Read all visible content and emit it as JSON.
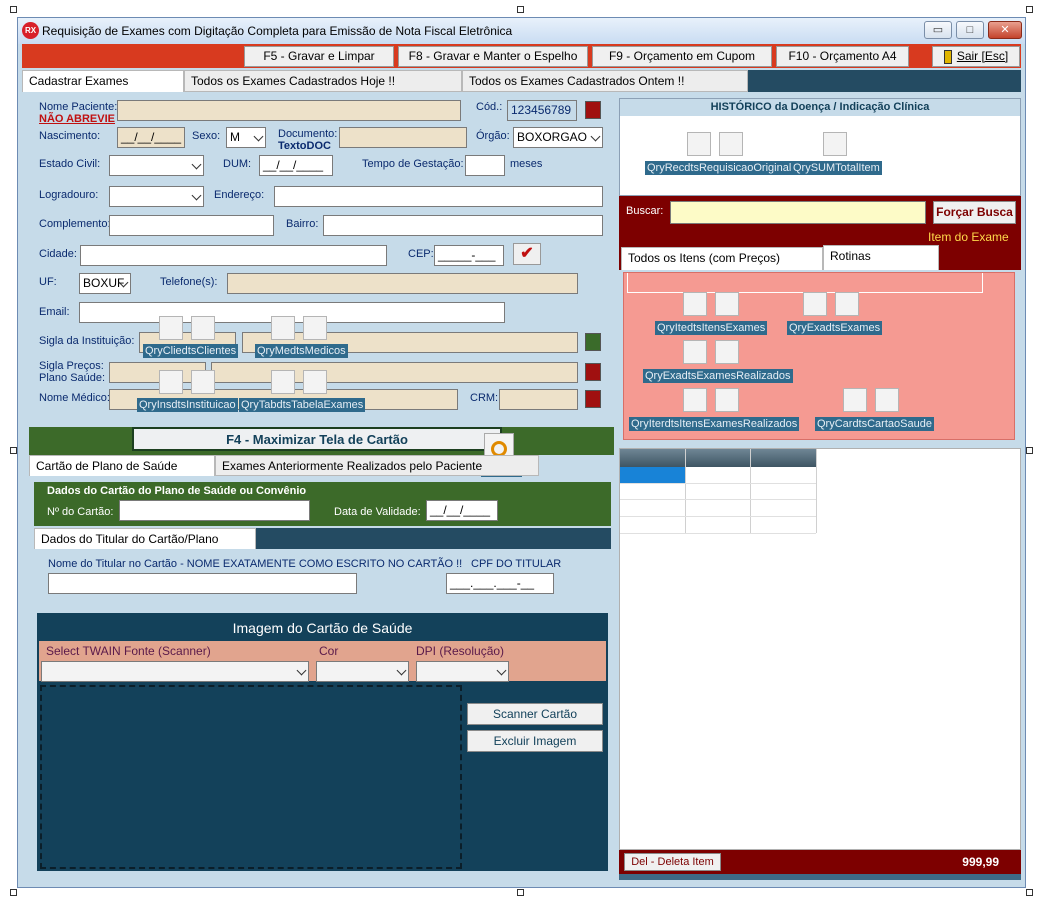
{
  "window": {
    "title": "Requisição de Exames com Digitação Completa para Emissão de Nota Fiscal Eletrônica",
    "app_icon": "RX",
    "controls": {
      "minimize": "▭",
      "maximize": "□",
      "close": "✕"
    }
  },
  "toolbar": {
    "f5": "F5 - Gravar e Limpar",
    "f8": "F8 - Gravar e Manter o Espelho",
    "f9": "F9 - Orçamento em Cupom",
    "f10": "F10 - Orçamento A4",
    "exit": "Sair [Esc]"
  },
  "tabs": [
    "Cadastrar Exames",
    "Todos os Exames Cadastrados Hoje !!",
    "Todos os Exames Cadastrados Ontem !!"
  ],
  "form": {
    "nome_paciente_label": "Nome Paciente:",
    "nao_abrevie": "NÃO ABREVIE",
    "cod_label": "Cód.:",
    "cod_value": "123456789",
    "nascimento_label": "Nascimento:",
    "nascimento_value": "__/__/____",
    "sexo_label": "Sexo:",
    "sexo_value": "M",
    "documento_label": "Documento:",
    "documento_sub": "TextoDOC",
    "orgao_label": "Órgão:",
    "orgao_value": "BOXORGAO",
    "estado_civil_label": "Estado Civil:",
    "dum_label": "DUM:",
    "dum_value": "__/__/____",
    "gestacao_label": "Tempo de Gestação:",
    "meses": "meses",
    "logradouro_label": "Logradouro:",
    "endereco_label": "Endereço:",
    "complemento_label": "Complemento:",
    "bairro_label": "Bairro:",
    "cidade_label": "Cidade:",
    "cep_label": "CEP:",
    "cep_value": "_____-___",
    "uf_label": "UF:",
    "uf_value": "BOXUF",
    "telefone_label": "Telefone(s):",
    "email_label": "Email:",
    "sigla_inst_label": "Sigla da Instituição:",
    "sigla_precos_label": "Sigla Preços:",
    "plano_saude_label": "Plano Saúde:",
    "nome_medico_label": "Nome Médico:",
    "crm_label": "CRM:"
  },
  "components": {
    "clientes": "QryCliedtsClientes",
    "medicos": "QryMedtsMedicos",
    "instituicao": "QryInsdtsInstituicao",
    "tabela": "QryTabdtsTabelaExames",
    "req_original": "QryRecdtsRequisicaoOriginal",
    "sum_total": "QrySUMTotalItem",
    "itens_exames": "QryItedtsItensExames",
    "exa_exames": "QryExadtsExames",
    "exames_realizados": "QryExadtsExamesRealizados",
    "itens_realizados": "QryIterdtsItensExamesRealizados",
    "cartao_saude": "QryCardtsCartaoSaude",
    "timer": "tmScan"
  },
  "card_section": {
    "maximize_button": "F4 - Maximizar Tela de Cartão",
    "tab_card": "Cartão de Plano de Saúde",
    "tab_prev": "Exames Anteriormente Realizados pelo Paciente",
    "dados_title": "Dados do Cartão do Plano de Saúde ou Convênio",
    "num_cartao_label": "Nº do Cartão:",
    "validade_label": "Data de Validade:",
    "validade_value": "__/__/____",
    "titular_tab": "Dados do Titular do Cartão/Plano",
    "nome_titular_label": "Nome do Titular no Cartão - NOME EXATAMENTE COMO ESCRITO NO CARTÃO !!",
    "cpf_label": "CPF DO TITULAR",
    "cpf_value": "___.___.___-__",
    "imagem_title": "Imagem do Cartão de Saúde",
    "twain_label": "Select TWAIN Fonte (Scanner)",
    "cor_label": "Cor",
    "dpi_label": "DPI (Resolução)",
    "scanner_button": "Scanner Cartão",
    "excluir_button": "Excluir Imagem"
  },
  "right_panel": {
    "historico_title": "HISTÓRICO da Doença / Indicação Clínica",
    "buscar_label": "Buscar:",
    "forcar_busca": "Forçar Busca",
    "item_exame": "Item do Exame",
    "tab_todos": "Todos os Itens (com Preços)",
    "tab_rotinas": "Rotinas",
    "del_button": "Del - Deleta Item",
    "total": "999,99"
  },
  "colors": {
    "toolbar_red": "#d83a1f",
    "dark_red": "#7d0000",
    "salmon": "#f59a92",
    "navy": "#13415a",
    "green": "#3c6a29"
  }
}
